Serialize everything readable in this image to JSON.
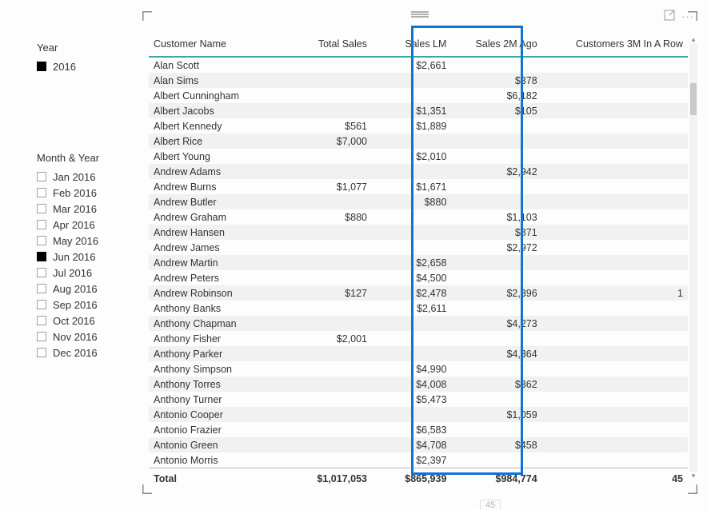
{
  "slicers": {
    "year": {
      "title": "Year",
      "items": [
        {
          "label": "2016",
          "checked": true
        }
      ]
    },
    "month": {
      "title": "Month & Year",
      "items": [
        {
          "label": "Jan 2016",
          "checked": false
        },
        {
          "label": "Feb 2016",
          "checked": false
        },
        {
          "label": "Mar 2016",
          "checked": false
        },
        {
          "label": "Apr 2016",
          "checked": false
        },
        {
          "label": "May 2016",
          "checked": false
        },
        {
          "label": "Jun 2016",
          "checked": true
        },
        {
          "label": "Jul 2016",
          "checked": false
        },
        {
          "label": "Aug 2016",
          "checked": false
        },
        {
          "label": "Sep 2016",
          "checked": false
        },
        {
          "label": "Oct 2016",
          "checked": false
        },
        {
          "label": "Nov 2016",
          "checked": false
        },
        {
          "label": "Dec 2016",
          "checked": false
        }
      ]
    }
  },
  "table": {
    "columns": [
      "Customer Name",
      "Total Sales",
      "Sales LM",
      "Sales 2M Ago",
      "Customers 3M In A Row"
    ],
    "rows": [
      {
        "name": "Alan Scott",
        "total": "",
        "lm": "$2,661",
        "m2": "",
        "c3": ""
      },
      {
        "name": "Alan Sims",
        "total": "",
        "lm": "",
        "m2": "$378",
        "c3": ""
      },
      {
        "name": "Albert Cunningham",
        "total": "",
        "lm": "",
        "m2": "$6,182",
        "c3": ""
      },
      {
        "name": "Albert Jacobs",
        "total": "",
        "lm": "$1,351",
        "m2": "$105",
        "c3": ""
      },
      {
        "name": "Albert Kennedy",
        "total": "$561",
        "lm": "$1,889",
        "m2": "",
        "c3": ""
      },
      {
        "name": "Albert Rice",
        "total": "$7,000",
        "lm": "",
        "m2": "",
        "c3": ""
      },
      {
        "name": "Albert Young",
        "total": "",
        "lm": "$2,010",
        "m2": "",
        "c3": ""
      },
      {
        "name": "Andrew Adams",
        "total": "",
        "lm": "",
        "m2": "$2,942",
        "c3": ""
      },
      {
        "name": "Andrew Burns",
        "total": "$1,077",
        "lm": "$1,671",
        "m2": "",
        "c3": ""
      },
      {
        "name": "Andrew Butler",
        "total": "",
        "lm": "$880",
        "m2": "",
        "c3": ""
      },
      {
        "name": "Andrew Graham",
        "total": "$880",
        "lm": "",
        "m2": "$1,103",
        "c3": ""
      },
      {
        "name": "Andrew Hansen",
        "total": "",
        "lm": "",
        "m2": "$871",
        "c3": ""
      },
      {
        "name": "Andrew James",
        "total": "",
        "lm": "",
        "m2": "$2,972",
        "c3": ""
      },
      {
        "name": "Andrew Martin",
        "total": "",
        "lm": "$2,658",
        "m2": "",
        "c3": ""
      },
      {
        "name": "Andrew Peters",
        "total": "",
        "lm": "$4,500",
        "m2": "",
        "c3": ""
      },
      {
        "name": "Andrew Robinson",
        "total": "$127",
        "lm": "$2,478",
        "m2": "$2,396",
        "c3": "1"
      },
      {
        "name": "Anthony Banks",
        "total": "",
        "lm": "$2,611",
        "m2": "",
        "c3": ""
      },
      {
        "name": "Anthony Chapman",
        "total": "",
        "lm": "",
        "m2": "$4,273",
        "c3": ""
      },
      {
        "name": "Anthony Fisher",
        "total": "$2,001",
        "lm": "",
        "m2": "",
        "c3": ""
      },
      {
        "name": "Anthony Parker",
        "total": "",
        "lm": "",
        "m2": "$4,364",
        "c3": ""
      },
      {
        "name": "Anthony Simpson",
        "total": "",
        "lm": "$4,990",
        "m2": "",
        "c3": ""
      },
      {
        "name": "Anthony Torres",
        "total": "",
        "lm": "$4,008",
        "m2": "$362",
        "c3": ""
      },
      {
        "name": "Anthony Turner",
        "total": "",
        "lm": "$5,473",
        "m2": "",
        "c3": ""
      },
      {
        "name": "Antonio Cooper",
        "total": "",
        "lm": "",
        "m2": "$1,059",
        "c3": ""
      },
      {
        "name": "Antonio Frazier",
        "total": "",
        "lm": "$6,583",
        "m2": "",
        "c3": ""
      },
      {
        "name": "Antonio Green",
        "total": "",
        "lm": "$4,708",
        "m2": "$458",
        "c3": ""
      },
      {
        "name": "Antonio Morris",
        "total": "",
        "lm": "$2,397",
        "m2": "",
        "c3": ""
      }
    ],
    "totals": {
      "label": "Total",
      "total": "$1,017,053",
      "lm": "$865,939",
      "m2": "$984,774",
      "c3": "45"
    }
  },
  "page_indicator": "45",
  "chart_data": {
    "type": "table",
    "title": "",
    "columns": [
      "Customer Name",
      "Total Sales",
      "Sales LM",
      "Sales 2M Ago",
      "Customers 3M In A Row"
    ],
    "rows": [
      [
        "Alan Scott",
        null,
        2661,
        null,
        null
      ],
      [
        "Alan Sims",
        null,
        null,
        378,
        null
      ],
      [
        "Albert Cunningham",
        null,
        null,
        6182,
        null
      ],
      [
        "Albert Jacobs",
        null,
        1351,
        105,
        null
      ],
      [
        "Albert Kennedy",
        561,
        1889,
        null,
        null
      ],
      [
        "Albert Rice",
        7000,
        null,
        null,
        null
      ],
      [
        "Albert Young",
        null,
        2010,
        null,
        null
      ],
      [
        "Andrew Adams",
        null,
        null,
        2942,
        null
      ],
      [
        "Andrew Burns",
        1077,
        1671,
        null,
        null
      ],
      [
        "Andrew Butler",
        null,
        880,
        null,
        null
      ],
      [
        "Andrew Graham",
        880,
        null,
        1103,
        null
      ],
      [
        "Andrew Hansen",
        null,
        null,
        871,
        null
      ],
      [
        "Andrew James",
        null,
        null,
        2972,
        null
      ],
      [
        "Andrew Martin",
        null,
        2658,
        null,
        null
      ],
      [
        "Andrew Peters",
        null,
        4500,
        null,
        null
      ],
      [
        "Andrew Robinson",
        127,
        2478,
        2396,
        1
      ],
      [
        "Anthony Banks",
        null,
        2611,
        null,
        null
      ],
      [
        "Anthony Chapman",
        null,
        null,
        4273,
        null
      ],
      [
        "Anthony Fisher",
        2001,
        null,
        null,
        null
      ],
      [
        "Anthony Parker",
        null,
        null,
        4364,
        null
      ],
      [
        "Anthony Simpson",
        null,
        4990,
        null,
        null
      ],
      [
        "Anthony Torres",
        null,
        4008,
        362,
        null
      ],
      [
        "Anthony Turner",
        null,
        5473,
        null,
        null
      ],
      [
        "Antonio Cooper",
        null,
        null,
        1059,
        null
      ],
      [
        "Antonio Frazier",
        null,
        6583,
        null,
        null
      ],
      [
        "Antonio Green",
        null,
        4708,
        458,
        null
      ],
      [
        "Antonio Morris",
        null,
        2397,
        null,
        null
      ]
    ],
    "totals": [
      "Total",
      1017053,
      865939,
      984774,
      45
    ]
  }
}
